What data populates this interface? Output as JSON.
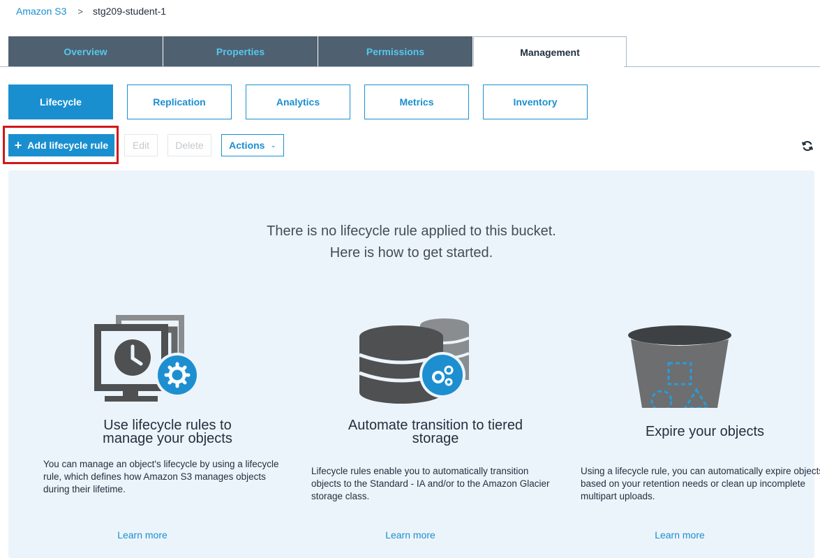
{
  "breadcrumb": {
    "root": "Amazon S3",
    "separator": ">",
    "current": "stg209-student-1"
  },
  "main_tabs": [
    {
      "label": "Overview"
    },
    {
      "label": "Properties"
    },
    {
      "label": "Permissions"
    },
    {
      "label": "Management",
      "active": true
    }
  ],
  "sub_tabs": [
    {
      "label": "Lifecycle",
      "active": true
    },
    {
      "label": "Replication"
    },
    {
      "label": "Analytics"
    },
    {
      "label": "Metrics"
    },
    {
      "label": "Inventory"
    }
  ],
  "toolbar": {
    "add_label": "Add lifecycle rule",
    "add_icon": "plus-icon",
    "edit_label": "Edit",
    "delete_label": "Delete",
    "actions_label": "Actions",
    "refresh_icon": "refresh-icon"
  },
  "empty_state": {
    "line1": "There is no lifecycle rule applied to this bucket.",
    "line2": "Here is how to get started."
  },
  "features": [
    {
      "icon": "monitor-clock-gear-icon",
      "title_line1": "Use lifecycle rules to",
      "title_line2": "manage your objects",
      "text": "You can manage an object's lifecycle by using a lifecycle rule, which defines how Amazon S3 manages objects during their lifetime.",
      "link": "Learn more"
    },
    {
      "icon": "storage-tiers-gear-icon",
      "title_line1": "Automate transition to tiered",
      "title_line2": "storage",
      "text": "Lifecycle rules enable you to automatically transition objects to the Standard - IA and/or to the Amazon Glacier storage class.",
      "link": "Learn more"
    },
    {
      "icon": "bucket-objects-icon",
      "title_line1": "Expire your objects",
      "title_line2": "",
      "text": "Using a lifecycle rule, you can automatically expire objects based on your retention needs or clean up incomplete multipart uploads.",
      "link": "Learn more"
    }
  ],
  "colors": {
    "accent": "#1a8fd0",
    "tab_dark": "#4f6070",
    "tab_text": "#55c8ee",
    "panel_bg": "#ecf4fb",
    "highlight": "#d0181b"
  }
}
